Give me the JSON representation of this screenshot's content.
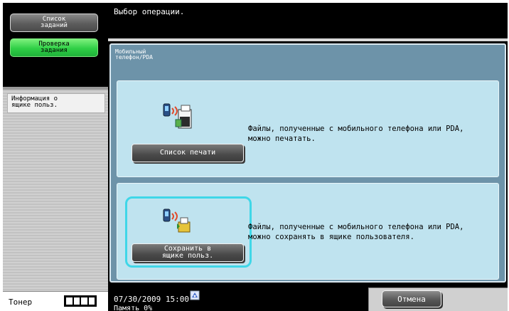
{
  "sidebar": {
    "job_list_label": "Список\nзаданий",
    "job_check_label": "Проверка\nзадания",
    "info_item_label": "Информация о\nящике польз.",
    "toner_label": "Тонер"
  },
  "header": {
    "message": "Выбор операции."
  },
  "panel": {
    "title": "Мобильный\nтелефон/PDA",
    "print_card": {
      "description": "Файлы, полученные с мобильного телефона или PDA,\nможно печатать.",
      "button_label": "Список печати",
      "icon": "mobile-print-icon"
    },
    "save_card": {
      "description": "Файлы, полученные с мобильного телефона или PDA,\nможно сохранять в ящике пользователя.",
      "button_label": "Сохранить в\nящике польз.",
      "icon": "mobile-save-icon"
    }
  },
  "footer": {
    "datetime": "07/30/2009   15:00",
    "memory_label": "Память       0%",
    "cancel_label": "Отмена",
    "status_icon": "network-status-icon"
  },
  "colors": {
    "panel_bg": "#6d93a9",
    "card_bg": "#bfe3ef",
    "highlight": "#3fd7e8",
    "active_green": "#2fcf46"
  }
}
